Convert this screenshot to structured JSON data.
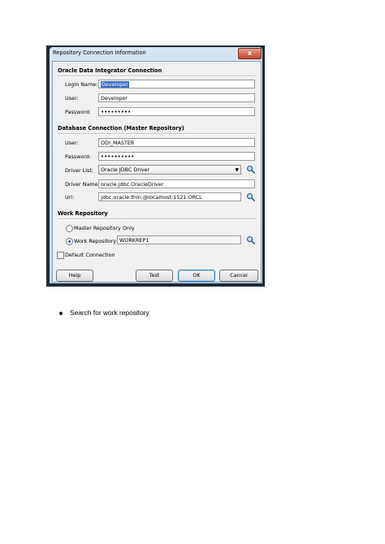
{
  "dialog": {
    "title": "Repository Connection Information",
    "close_label": "x",
    "odi_section": "Oracle Data Integrator Connection",
    "login_name_label": "Login Name:",
    "login_name_value": "Developer",
    "user_label": "User:",
    "user_value": "Developer",
    "password_label": "Password:",
    "password_value": "•••••••••",
    "db_section": "Database Connection (Master Repository)",
    "db_user_label": "User:",
    "db_user_value": "ODI_MASTER",
    "db_password_label": "Password:",
    "db_password_value": "••••••••••",
    "driver_list_label": "Driver List:",
    "driver_list_value": "Oracle JDBC Driver",
    "driver_name_label": "Driver Name:",
    "driver_name_value": "oracle.jdbc.OracleDriver",
    "url_label": "Url:",
    "url_value": "jdbc:oracle:thin:@localhost:1521:ORCL",
    "work_section": "Work Repository",
    "master_only_label": "Master Repository Only",
    "master_only_selected": false,
    "work_repo_label": "Work Repository",
    "work_repo_selected": true,
    "work_repo_value": "WORKREP1",
    "default_connection_label": "Default Connection",
    "default_connection_checked": false,
    "buttons": {
      "help": "Help",
      "test": "Test",
      "ok": "OK",
      "cancel": "Cancel"
    }
  },
  "document": {
    "bullet_text": "Search for work repository"
  }
}
